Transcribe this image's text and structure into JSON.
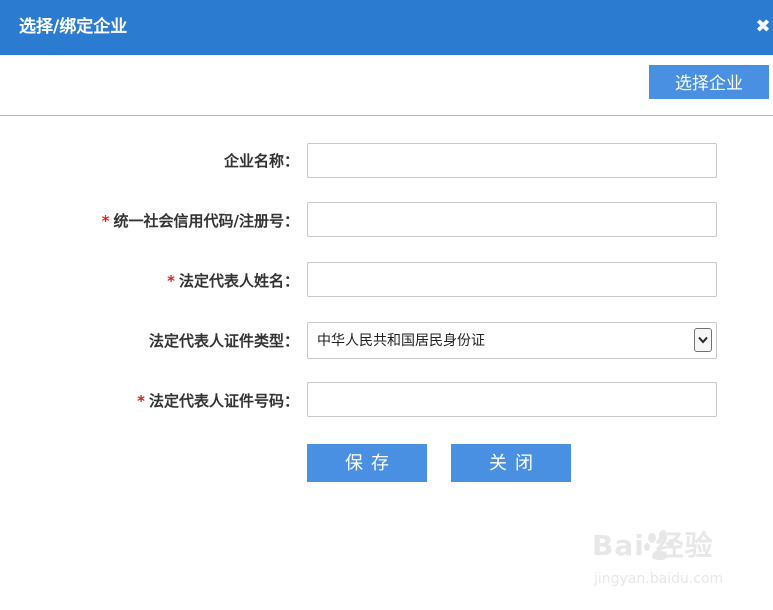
{
  "dialog": {
    "title": "选择/绑定企业",
    "close_glyph": "✖"
  },
  "toolbar": {
    "select_company_label": "选择企业"
  },
  "form": {
    "fields": [
      {
        "label": "企业名称：",
        "required": false,
        "value": ""
      },
      {
        "label": "统一社会信用代码/注册号：",
        "required": true,
        "value": ""
      },
      {
        "label": "法定代表人姓名：",
        "required": true,
        "value": ""
      },
      {
        "label": "法定代表人证件类型：",
        "required": false,
        "selected": "中华人民共和国居民身份证"
      },
      {
        "label": "法定代表人证件号码：",
        "required": true,
        "value": ""
      }
    ],
    "required_mark": "*"
  },
  "actions": {
    "save_label": "保存",
    "close_label": "关闭"
  },
  "watermark": {
    "brand": "Bai 经验",
    "url": "jingyan.baidu.com"
  },
  "colors": {
    "titlebar": "#2b7bd0",
    "button": "#4a90e2",
    "required": "#d9231f"
  }
}
